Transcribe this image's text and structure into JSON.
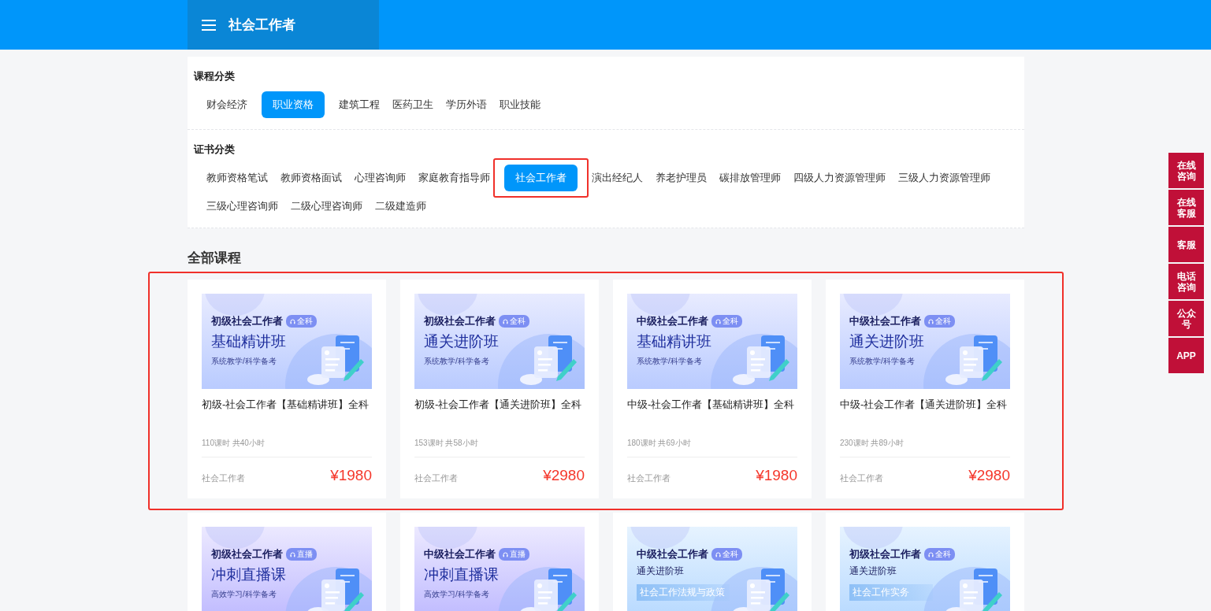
{
  "header": {
    "title": "社会工作者"
  },
  "course_category": {
    "label": "课程分类",
    "items": [
      {
        "label": "财会经济",
        "selected": false
      },
      {
        "label": "职业资格",
        "selected": true
      },
      {
        "label": "建筑工程",
        "selected": false
      },
      {
        "label": "医药卫生",
        "selected": false
      },
      {
        "label": "学历外语",
        "selected": false
      },
      {
        "label": "职业技能",
        "selected": false
      }
    ]
  },
  "certificate_category": {
    "label": "证书分类",
    "items": [
      {
        "label": "教师资格笔试",
        "selected": false,
        "highlighted": false
      },
      {
        "label": "教师资格面试",
        "selected": false,
        "highlighted": false
      },
      {
        "label": "心理咨询师",
        "selected": false,
        "highlighted": false
      },
      {
        "label": "家庭教育指导师",
        "selected": false,
        "highlighted": false
      },
      {
        "label": "社会工作者",
        "selected": true,
        "highlighted": true
      },
      {
        "label": "演出经纪人",
        "selected": false,
        "highlighted": false
      },
      {
        "label": "养老护理员",
        "selected": false,
        "highlighted": false
      },
      {
        "label": "碳排放管理师",
        "selected": false,
        "highlighted": false
      },
      {
        "label": "四级人力资源管理师",
        "selected": false,
        "highlighted": false
      },
      {
        "label": "三级人力资源管理师",
        "selected": false,
        "highlighted": false
      },
      {
        "label": "三级心理咨询师",
        "selected": false,
        "highlighted": false
      },
      {
        "label": "二级心理咨询师",
        "selected": false,
        "highlighted": false
      },
      {
        "label": "二级建造师",
        "selected": false,
        "highlighted": false
      }
    ]
  },
  "all_courses": {
    "title": "全部课程",
    "rows": [
      {
        "highlighted": true,
        "courses": [
          {
            "banner": {
              "kind": "classic",
              "level": "初级社会工作者",
              "tag": "全科",
              "title": "基础精讲班",
              "subtitle": "系统教学/科学备考"
            },
            "name": "初级-社会工作者【基础精讲班】全科",
            "hours": "110课时 共40小时",
            "category": "社会工作者",
            "price": "¥1980"
          },
          {
            "banner": {
              "kind": "classic",
              "level": "初级社会工作者",
              "tag": "全科",
              "title": "通关进阶班",
              "subtitle": "系统教学/科学备考"
            },
            "name": "初级-社会工作者【通关进阶班】全科",
            "hours": "153课时 共58小时",
            "category": "社会工作者",
            "price": "¥2980"
          },
          {
            "banner": {
              "kind": "classic",
              "level": "中级社会工作者",
              "tag": "全科",
              "title": "基础精讲班",
              "subtitle": "系统教学/科学备考"
            },
            "name": "中级-社会工作者【基础精讲班】全科",
            "hours": "180课时 共69小时",
            "category": "社会工作者",
            "price": "¥1980"
          },
          {
            "banner": {
              "kind": "classic",
              "level": "中级社会工作者",
              "tag": "全科",
              "title": "通关进阶班",
              "subtitle": "系统教学/科学备考"
            },
            "name": "中级-社会工作者【通关进阶班】全科",
            "hours": "230课时 共89小时",
            "category": "社会工作者",
            "price": "¥2980"
          }
        ]
      },
      {
        "highlighted": false,
        "courses": [
          {
            "banner": {
              "kind": "live",
              "level": "初级社会工作者",
              "tag": "直播",
              "title": "冲刺直播课",
              "subtitle": "高效学习/科学备考"
            }
          },
          {
            "banner": {
              "kind": "live",
              "level": "中级社会工作者",
              "tag": "直播",
              "title": "冲刺直播课",
              "subtitle": "高效学习/科学备考"
            }
          },
          {
            "banner": {
              "kind": "subject",
              "level": "中级社会工作者",
              "tag": "全科",
              "title": "通关进阶班",
              "subtitle": "社会工作法规与政策"
            }
          },
          {
            "banner": {
              "kind": "subject",
              "level": "初级社会工作者",
              "tag": "全科",
              "title": "通关进阶班",
              "subtitle": "社会工作实务"
            }
          }
        ]
      }
    ]
  },
  "side_bar": [
    {
      "label": "在线咨询"
    },
    {
      "label": "在线客服"
    },
    {
      "label": "客服"
    },
    {
      "label": "电话咨询"
    },
    {
      "label": "公众号"
    },
    {
      "label": "APP"
    }
  ]
}
